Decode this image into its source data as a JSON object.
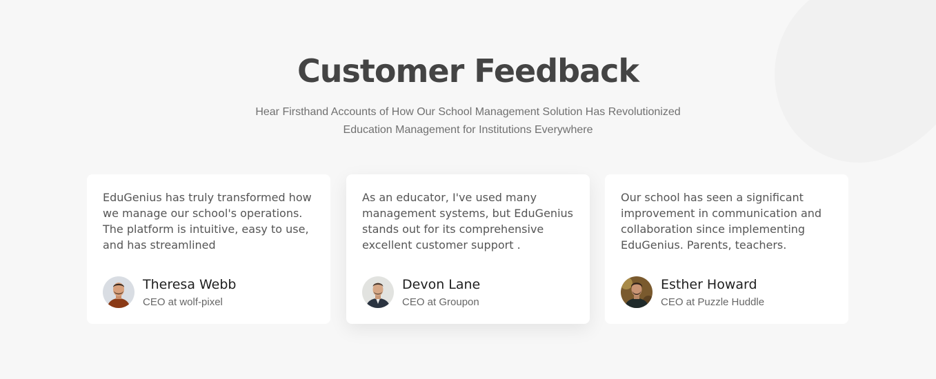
{
  "header": {
    "title": "Customer Feedback",
    "subtitle_lines": [
      "Hear Firsthand Accounts of How Our School Management Solution Has Revolutionized",
      "Education Management for Institutions Everywhere"
    ]
  },
  "testimonials": [
    {
      "quote_lines": [
        "EduGenius has truly transformed how",
        "we manage our school's operations.",
        "The platform is intuitive, easy to use,",
        "and has streamlined"
      ],
      "name": "Theresa Webb",
      "role": "CEO at wolf-pixel",
      "avatar_icon": "man-avatar-orange-shirt"
    },
    {
      "quote_lines": [
        "As an educator, I've used many",
        "management systems, but EduGenius",
        "stands out for its comprehensive",
        "excellent customer support ."
      ],
      "name": "Devon Lane",
      "role": "CEO at Groupon",
      "avatar_icon": "man-avatar-dark-jacket"
    },
    {
      "quote_lines": [
        "Our school has seen a significant",
        "improvement in communication and",
        "collaboration since implementing",
        "EduGenius. Parents, teachers."
      ],
      "name": "Esther Howard",
      "role": "CEO at Puzzle Huddle",
      "avatar_icon": "man-avatar-outdoor"
    }
  ],
  "colors": {
    "background": "#f7f7f7",
    "card": "#ffffff",
    "title": "#444444",
    "body_text": "#555555"
  }
}
